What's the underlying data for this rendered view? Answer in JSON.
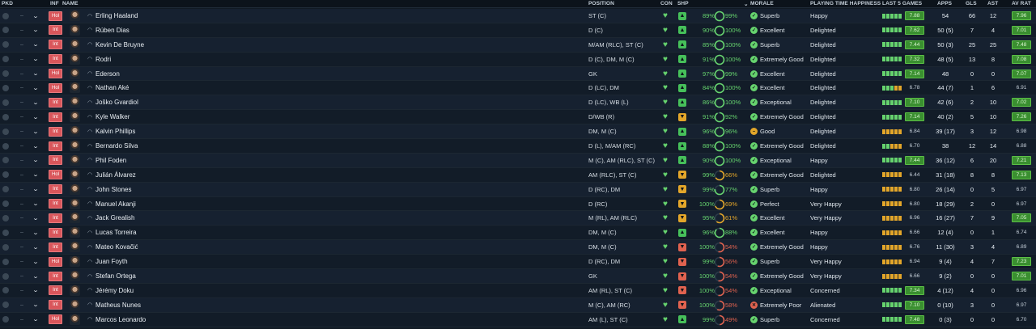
{
  "columns": {
    "pkd": "PKD",
    "inf": "INF",
    "name": "NAME",
    "position": "POSITION",
    "con": "CON",
    "shp": "SHP",
    "morale": "MORALE",
    "pth": "PLAYING TIME HAPPINESS",
    "last5": "LAST 5 GAMES",
    "apps": "APPS",
    "gls": "GLS",
    "ast": "AST",
    "avrat": "AV RAT"
  },
  "colors": {
    "inf_badge": "#d9565b",
    "good": "#66d36e",
    "warn": "#e3a62a",
    "bad": "#e0624f",
    "highlight": "#3a8f30"
  },
  "players": [
    {
      "inf": "Hol",
      "name": "Erling Haaland",
      "position": "ST (C)",
      "shp": "up",
      "cond": "89%",
      "sharp": "99%",
      "sharp_val": 0.99,
      "sharp_col": "good",
      "morale": "Superb",
      "mor": "good",
      "pth": "Happy",
      "form": [
        "g",
        "g",
        "g",
        "g",
        "g"
      ],
      "last": "7.88",
      "last_hi": true,
      "apps": "54",
      "gls": "66",
      "ast": "12",
      "avr": "7.96",
      "avr_hi": true
    },
    {
      "inf": "Int",
      "name": "Rúben Dias",
      "position": "D (C)",
      "shp": "up",
      "cond": "90%",
      "sharp": "100%",
      "sharp_val": 1,
      "sharp_col": "good",
      "morale": "Excellent",
      "mor": "good",
      "pth": "Delighted",
      "form": [
        "g",
        "g",
        "g",
        "g",
        "g"
      ],
      "last": "7.62",
      "last_hi": true,
      "apps": "50 (5)",
      "gls": "7",
      "ast": "4",
      "avr": "7.01",
      "avr_hi": true
    },
    {
      "inf": "Int",
      "name": "Kevin De Bruyne",
      "position": "M/AM (RLC), ST (C)",
      "shp": "up",
      "cond": "85%",
      "sharp": "100%",
      "sharp_val": 1,
      "sharp_col": "good",
      "morale": "Superb",
      "mor": "good",
      "pth": "Delighted",
      "form": [
        "g",
        "g",
        "g",
        "g",
        "g"
      ],
      "last": "7.44",
      "last_hi": true,
      "apps": "50 (3)",
      "gls": "25",
      "ast": "25",
      "avr": "7.48",
      "avr_hi": true
    },
    {
      "inf": "Int",
      "name": "Rodri",
      "position": "D (C), DM, M (C)",
      "shp": "up",
      "cond": "91%",
      "sharp": "100%",
      "sharp_val": 1,
      "sharp_col": "good",
      "morale": "Extremely Good",
      "mor": "good",
      "pth": "Delighted",
      "form": [
        "g",
        "g",
        "g",
        "g",
        "g"
      ],
      "last": "7.32",
      "last_hi": true,
      "apps": "48 (5)",
      "gls": "13",
      "ast": "8",
      "avr": "7.08",
      "avr_hi": true
    },
    {
      "inf": "Hol",
      "name": "Ederson",
      "position": "GK",
      "shp": "up",
      "cond": "97%",
      "sharp": "99%",
      "sharp_val": 0.99,
      "sharp_col": "good",
      "morale": "Excellent",
      "mor": "good",
      "pth": "Delighted",
      "form": [
        "g",
        "g",
        "g",
        "g",
        "g"
      ],
      "last": "7.14",
      "last_hi": true,
      "apps": "48",
      "gls": "0",
      "ast": "0",
      "avr": "7.07",
      "avr_hi": true
    },
    {
      "inf": "Hol",
      "name": "Nathan Aké",
      "position": "D (LC), DM",
      "shp": "up",
      "cond": "84%",
      "sharp": "100%",
      "sharp_val": 1,
      "sharp_col": "good",
      "morale": "Excellent",
      "mor": "good",
      "pth": "Delighted",
      "form": [
        "g",
        "g",
        "g",
        "o",
        "o"
      ],
      "last": "6.78",
      "last_hi": false,
      "apps": "44 (7)",
      "gls": "1",
      "ast": "6",
      "avr": "6.91",
      "avr_hi": false
    },
    {
      "inf": "Int",
      "name": "Joško Gvardiol",
      "position": "D (LC), WB (L)",
      "shp": "up",
      "cond": "86%",
      "sharp": "100%",
      "sharp_val": 1,
      "sharp_col": "good",
      "morale": "Exceptional",
      "mor": "good",
      "pth": "Delighted",
      "form": [
        "g",
        "g",
        "g",
        "g",
        "g"
      ],
      "last": "7.10",
      "last_hi": true,
      "apps": "42 (6)",
      "gls": "2",
      "ast": "10",
      "avr": "7.02",
      "avr_hi": true
    },
    {
      "inf": "Int",
      "name": "Kyle Walker",
      "position": "D/WB (R)",
      "shp": "flat",
      "cond": "91%",
      "sharp": "92%",
      "sharp_val": 0.92,
      "sharp_col": "good",
      "morale": "Extremely Good",
      "mor": "good",
      "pth": "Delighted",
      "form": [
        "g",
        "g",
        "g",
        "g",
        "g"
      ],
      "last": "7.14",
      "last_hi": true,
      "apps": "40 (2)",
      "gls": "5",
      "ast": "10",
      "avr": "7.26",
      "avr_hi": true
    },
    {
      "inf": "Int",
      "name": "Kalvin Phillips",
      "position": "DM, M (C)",
      "shp": "up",
      "cond": "96%",
      "sharp": "96%",
      "sharp_val": 0.96,
      "sharp_col": "good",
      "morale": "Good",
      "mor": "warn",
      "pth": "Delighted",
      "form": [
        "o",
        "o",
        "o",
        "o",
        "o"
      ],
      "last": "6.84",
      "last_hi": false,
      "apps": "39 (17)",
      "gls": "3",
      "ast": "12",
      "avr": "6.98",
      "avr_hi": false
    },
    {
      "inf": "Int",
      "name": "Bernardo Silva",
      "position": "D (L), M/AM (RC)",
      "shp": "up",
      "cond": "88%",
      "sharp": "100%",
      "sharp_val": 1,
      "sharp_col": "good",
      "morale": "Extremely Good",
      "mor": "good",
      "pth": "Delighted",
      "form": [
        "g",
        "g",
        "o",
        "o",
        "o"
      ],
      "last": "6.70",
      "last_hi": false,
      "apps": "38",
      "gls": "12",
      "ast": "14",
      "avr": "6.88",
      "avr_hi": false
    },
    {
      "inf": "Int",
      "name": "Phil Foden",
      "position": "M (C), AM (RLC), ST (C)",
      "shp": "up",
      "cond": "90%",
      "sharp": "100%",
      "sharp_val": 1,
      "sharp_col": "good",
      "morale": "Exceptional",
      "mor": "good",
      "pth": "Happy",
      "form": [
        "g",
        "g",
        "g",
        "g",
        "g"
      ],
      "last": "7.44",
      "last_hi": true,
      "apps": "36 (12)",
      "gls": "6",
      "ast": "20",
      "avr": "7.21",
      "avr_hi": true
    },
    {
      "inf": "Hol",
      "name": "Julián Álvarez",
      "position": "AM (RLC), ST (C)",
      "shp": "flat",
      "cond": "99%",
      "sharp": "66%",
      "sharp_val": 0.66,
      "sharp_col": "warn",
      "morale": "Extremely Good",
      "mor": "good",
      "pth": "Delighted",
      "form": [
        "o",
        "o",
        "o",
        "o",
        "o"
      ],
      "last": "6.44",
      "last_hi": false,
      "apps": "31 (18)",
      "gls": "8",
      "ast": "8",
      "avr": "7.13",
      "avr_hi": true
    },
    {
      "inf": "Int",
      "name": "John Stones",
      "position": "D (RC), DM",
      "shp": "flat",
      "cond": "99%",
      "sharp": "77%",
      "sharp_val": 0.77,
      "sharp_col": "good",
      "morale": "Superb",
      "mor": "good",
      "pth": "Happy",
      "form": [
        "o",
        "o",
        "o",
        "o",
        "o"
      ],
      "last": "6.80",
      "last_hi": false,
      "apps": "26 (14)",
      "gls": "0",
      "ast": "5",
      "avr": "6.97",
      "avr_hi": false
    },
    {
      "inf": "Int",
      "name": "Manuel Akanji",
      "position": "D (RC)",
      "shp": "flat",
      "cond": "100%",
      "sharp": "69%",
      "sharp_val": 0.69,
      "sharp_col": "warn",
      "morale": "Perfect",
      "mor": "good",
      "pth": "Very Happy",
      "form": [
        "o",
        "o",
        "o",
        "o",
        "o"
      ],
      "last": "6.80",
      "last_hi": false,
      "apps": "18 (29)",
      "gls": "2",
      "ast": "0",
      "avr": "6.97",
      "avr_hi": false
    },
    {
      "inf": "Int",
      "name": "Jack Grealish",
      "position": "M (RL), AM (RLC)",
      "shp": "flat",
      "cond": "95%",
      "sharp": "61%",
      "sharp_val": 0.61,
      "sharp_col": "warn",
      "morale": "Excellent",
      "mor": "good",
      "pth": "Very Happy",
      "form": [
        "o",
        "o",
        "o",
        "o",
        "o"
      ],
      "last": "6.96",
      "last_hi": false,
      "apps": "16 (27)",
      "gls": "7",
      "ast": "9",
      "avr": "7.05",
      "avr_hi": true
    },
    {
      "inf": "Int",
      "name": "Lucas Torreira",
      "position": "DM, M (C)",
      "shp": "up",
      "cond": "96%",
      "sharp": "88%",
      "sharp_val": 0.88,
      "sharp_col": "good",
      "morale": "Excellent",
      "mor": "good",
      "pth": "Happy",
      "form": [
        "o",
        "o",
        "o",
        "o",
        "o"
      ],
      "last": "6.66",
      "last_hi": false,
      "apps": "12 (4)",
      "gls": "0",
      "ast": "1",
      "avr": "6.74",
      "avr_hi": false
    },
    {
      "inf": "Int",
      "name": "Mateo Kovačić",
      "position": "DM, M (C)",
      "shp": "down",
      "cond": "100%",
      "sharp": "54%",
      "sharp_val": 0.54,
      "sharp_col": "bad",
      "morale": "Extremely Good",
      "mor": "good",
      "pth": "Happy",
      "form": [
        "o",
        "o",
        "o",
        "o",
        "o"
      ],
      "last": "6.76",
      "last_hi": false,
      "apps": "11 (30)",
      "gls": "3",
      "ast": "4",
      "avr": "6.89",
      "avr_hi": false
    },
    {
      "inf": "Hol",
      "name": "Juan Foyth",
      "position": "D (RC), DM",
      "shp": "down",
      "cond": "99%",
      "sharp": "56%",
      "sharp_val": 0.56,
      "sharp_col": "bad",
      "morale": "Superb",
      "mor": "good",
      "pth": "Very Happy",
      "form": [
        "o",
        "o",
        "o",
        "o",
        "o"
      ],
      "last": "6.94",
      "last_hi": false,
      "apps": "9 (4)",
      "gls": "4",
      "ast": "7",
      "avr": "7.23",
      "avr_hi": true
    },
    {
      "inf": "Int",
      "name": "Stefan Ortega",
      "position": "GK",
      "shp": "down",
      "cond": "100%",
      "sharp": "54%",
      "sharp_val": 0.54,
      "sharp_col": "bad",
      "morale": "Extremely Good",
      "mor": "good",
      "pth": "Very Happy",
      "form": [
        "o",
        "o",
        "o",
        "o",
        "o"
      ],
      "last": "6.66",
      "last_hi": false,
      "apps": "9 (2)",
      "gls": "0",
      "ast": "0",
      "avr": "7.01",
      "avr_hi": true
    },
    {
      "inf": "Int",
      "name": "Jérémy Doku",
      "position": "AM (RL), ST (C)",
      "shp": "down",
      "cond": "100%",
      "sharp": "54%",
      "sharp_val": 0.54,
      "sharp_col": "bad",
      "morale": "Exceptional",
      "mor": "good",
      "pth": "Concerned",
      "form": [
        "g",
        "g",
        "g",
        "g",
        "g"
      ],
      "last": "7.34",
      "last_hi": true,
      "apps": "4 (12)",
      "gls": "4",
      "ast": "0",
      "avr": "6.96",
      "avr_hi": false
    },
    {
      "inf": "Int",
      "name": "Matheus Nunes",
      "position": "M (C), AM (RC)",
      "shp": "down",
      "cond": "100%",
      "sharp": "58%",
      "sharp_val": 0.58,
      "sharp_col": "bad",
      "morale": "Extremely Poor",
      "mor": "bad",
      "pth": "Alienated",
      "form": [
        "g",
        "g",
        "g",
        "g",
        "g"
      ],
      "last": "7.10",
      "last_hi": true,
      "apps": "0 (10)",
      "gls": "3",
      "ast": "0",
      "avr": "6.97",
      "avr_hi": false
    },
    {
      "inf": "Hol",
      "name": "Marcos Leonardo",
      "position": "AM (L), ST (C)",
      "shp": "up",
      "cond": "99%",
      "sharp": "49%",
      "sharp_val": 0.49,
      "sharp_col": "bad",
      "morale": "Superb",
      "mor": "good",
      "pth": "Concerned",
      "form": [
        "g",
        "g",
        "g",
        "g",
        "g"
      ],
      "last": "7.48",
      "last_hi": true,
      "apps": "0 (3)",
      "gls": "0",
      "ast": "0",
      "avr": "6.70",
      "avr_hi": false
    }
  ]
}
